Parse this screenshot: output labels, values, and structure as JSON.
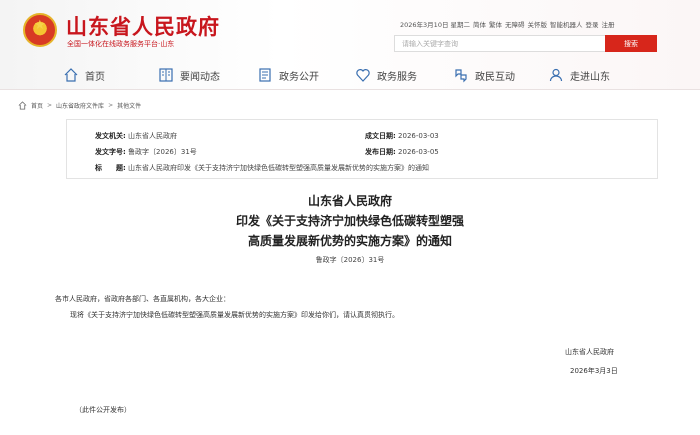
{
  "header": {
    "title": "山东省人民政府",
    "subtitle": "全国一体化在线政务服务平台·山东",
    "top_links": [
      "2026年3月10日 星期二",
      "简体",
      "繁体",
      "无障碍",
      "关怀版",
      "智能机器人",
      "登录",
      "注册"
    ],
    "search": {
      "placeholder": "请输入关键字查询",
      "button_label": "搜索"
    },
    "nav": [
      {
        "label": "首页",
        "icon": "home-icon"
      },
      {
        "label": "要闻动态",
        "icon": "news-icon"
      },
      {
        "label": "政务公开",
        "icon": "document-icon"
      },
      {
        "label": "政务服务",
        "icon": "heart-icon"
      },
      {
        "label": "政民互动",
        "icon": "interaction-icon"
      },
      {
        "label": "走进山东",
        "icon": "person-icon"
      }
    ]
  },
  "breadcrumb": [
    "首页",
    "山东省政府文件库",
    "其他文件"
  ],
  "meta": {
    "issuer_label": "发文机关:",
    "issuer": "山东省人民政府",
    "date_label": "成文日期:",
    "date": "2026-03-03",
    "number_label": "发文字号:",
    "number": "鲁政字〔2026〕31号",
    "publish_label": "发布日期:",
    "publish_date": "2026-03-05",
    "title_label": "标　　题:",
    "title": "山东省人民政府印发《关于支持济宁加快绿色低碳转型塑强高质量发展新优势的实施方案》的通知"
  },
  "document": {
    "title_lines": [
      "山东省人民政府",
      "印发《关于支持济宁加快绿色低碳转型塑强",
      "高质量发展新优势的实施方案》的通知"
    ],
    "doc_number": "鲁政字〔2026〕31号",
    "salutation": "各市人民政府，省政府各部门、各直属机构，各大企业：",
    "body": "现将《关于支持济宁加快绿色低碳转型塑强高质量发展新优势的实施方案》印发给你们，请认真贯彻执行。",
    "signer": "山东省人民政府",
    "sign_date": "2026年3月3日",
    "note": "（此件公开发布）"
  },
  "colors": {
    "brand_red": "#c8161d",
    "search_button": "#d7261b",
    "nav_icon": "#3a6fb0"
  }
}
